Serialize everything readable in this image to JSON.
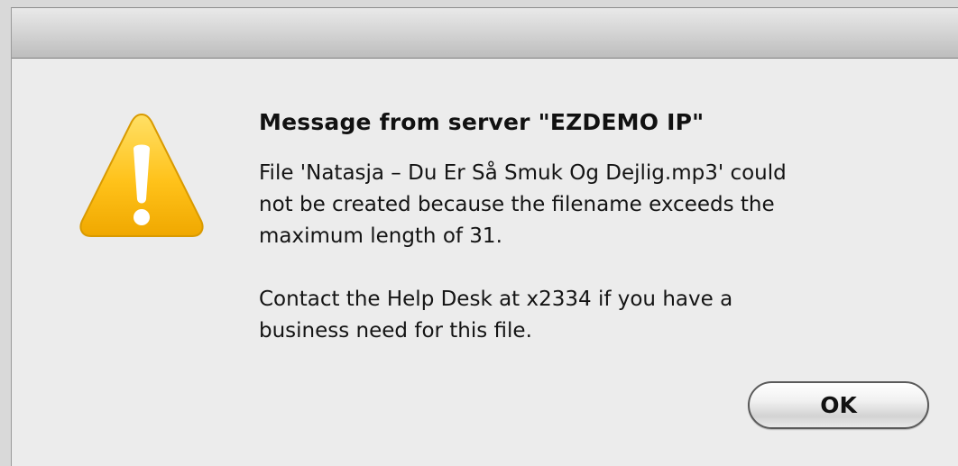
{
  "dialog": {
    "icon": "warning-icon",
    "title": "Message from server \"EZDEMO IP\"",
    "body": [
      "File 'Natasja – Du Er Så Smuk Og Dejlig.mp3' could\nnot be created because the filename exceeds the\nmaximum length of 31.",
      "Contact the Help Desk at x2334 if you have a\nbusiness need for this file."
    ],
    "ok_label": "OK"
  },
  "colors": {
    "warning_fill": "#f5b700",
    "warning_light": "#ffd84a",
    "background": "#ececec"
  }
}
